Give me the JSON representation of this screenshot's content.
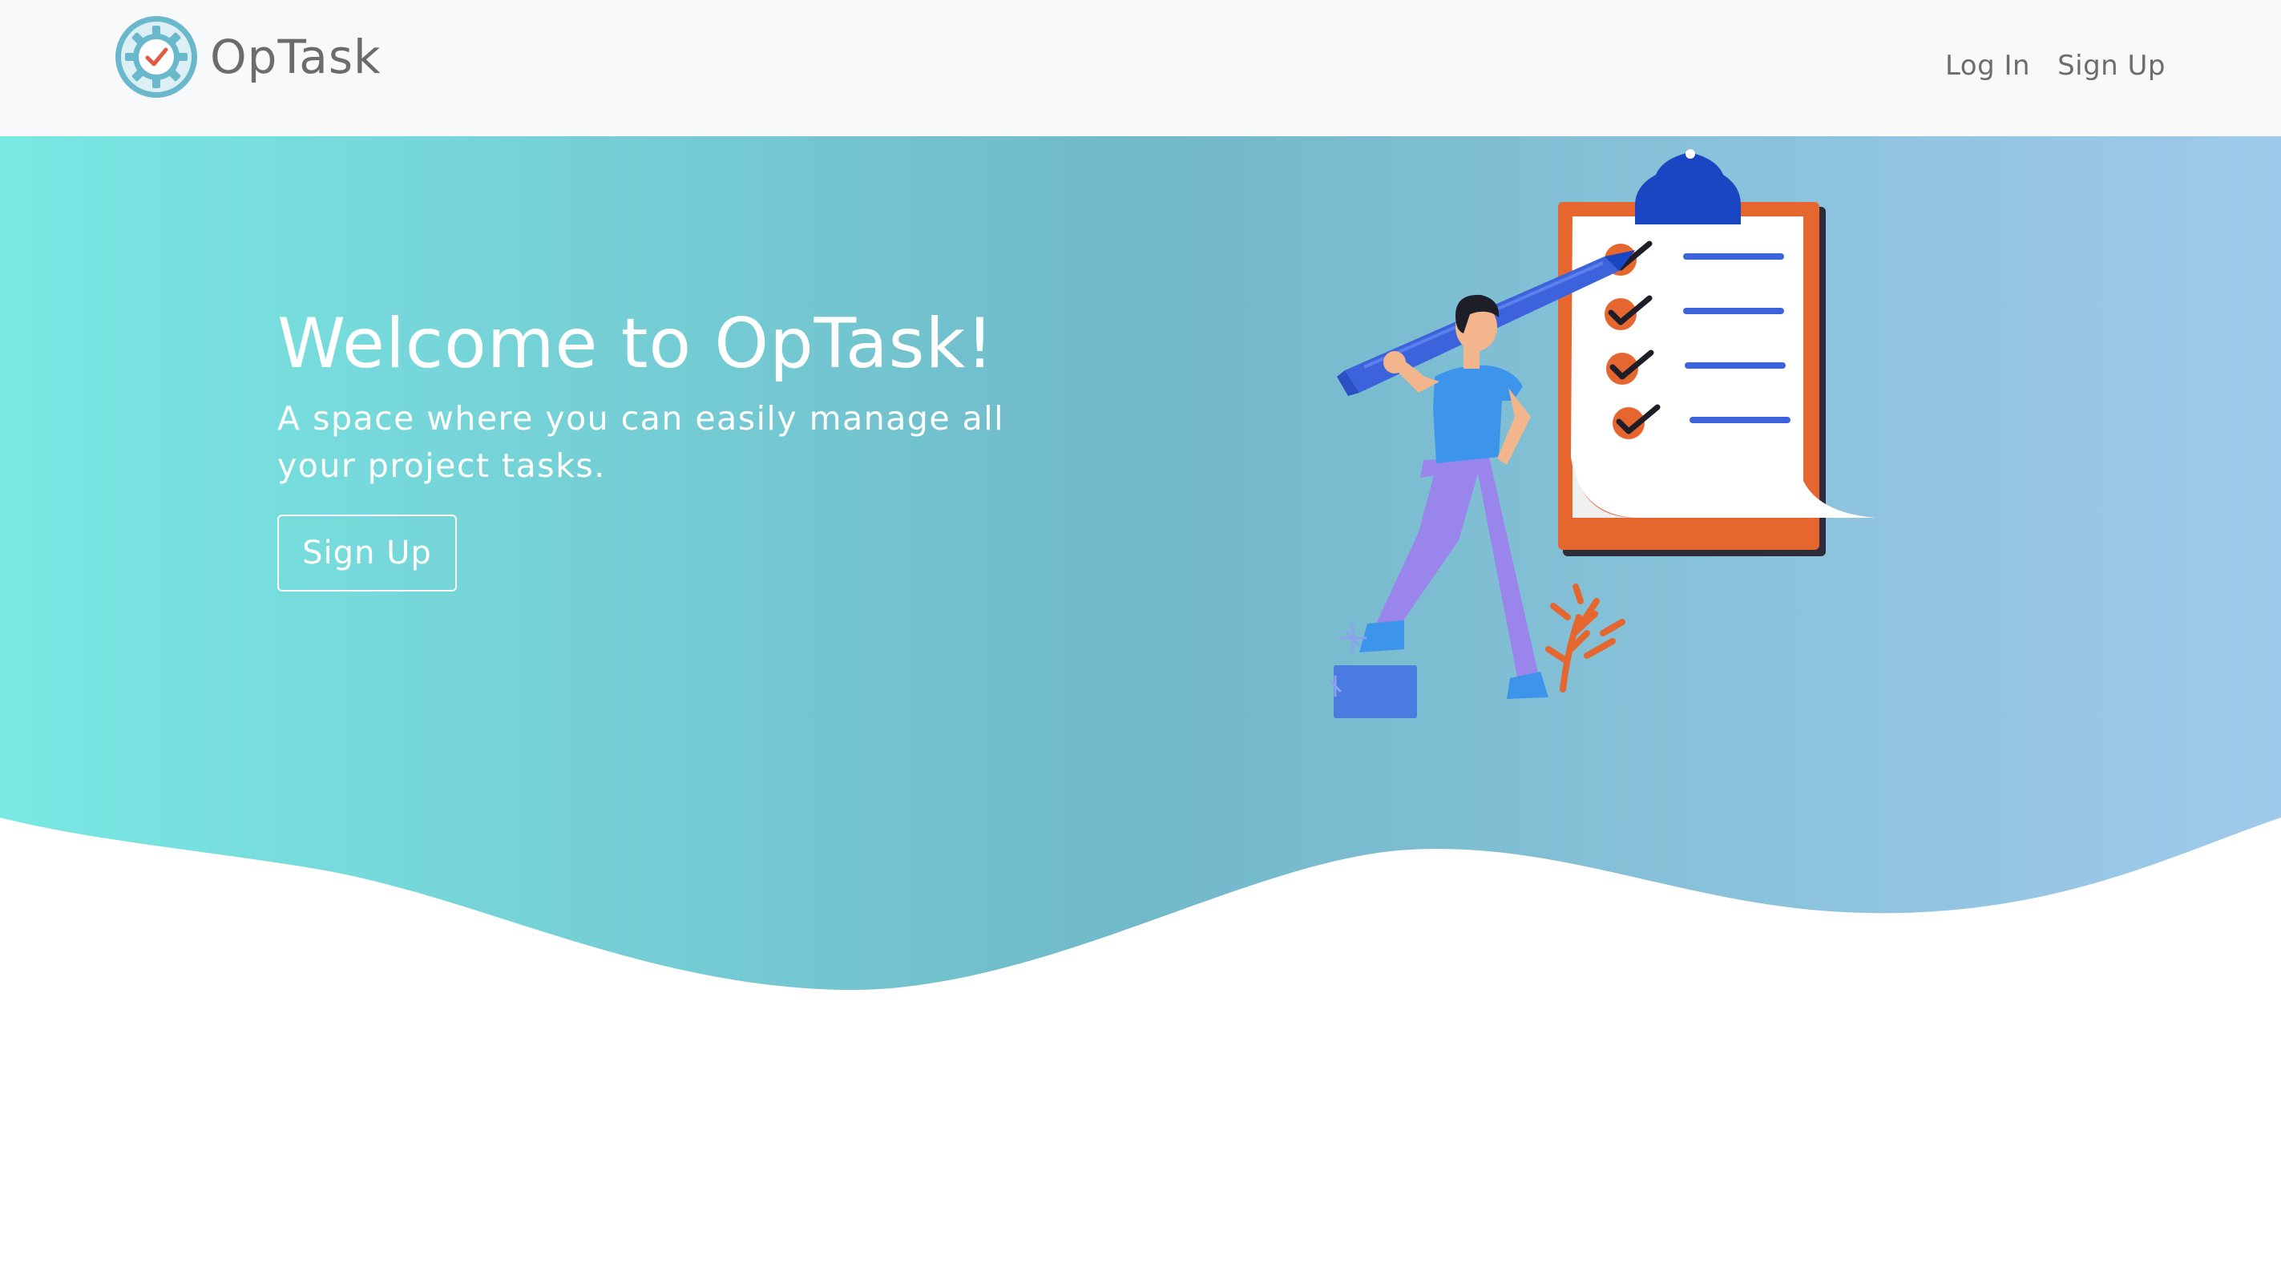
{
  "navbar": {
    "brand_name": "OpTask",
    "links": {
      "login": "Log In",
      "signup": "Sign Up"
    }
  },
  "hero": {
    "title": "Welcome to OpTask!",
    "subtitle": "A space where you can easily manage all your project tasks.",
    "cta_label": "Sign Up"
  },
  "colors": {
    "gradient_start": "#79e8e3",
    "gradient_mid": "#71b9c9",
    "gradient_end": "#a0caeb",
    "logo_ring": "#6ab8cc",
    "logo_check": "#e05a45",
    "clipboard_frame": "#e5672f",
    "clipboard_clip": "#1b46c2",
    "pencil": "#3d63dc",
    "shirt": "#3c95ea",
    "pants": "#9a85ec"
  },
  "icons": {
    "logo": "gear-check-icon"
  }
}
